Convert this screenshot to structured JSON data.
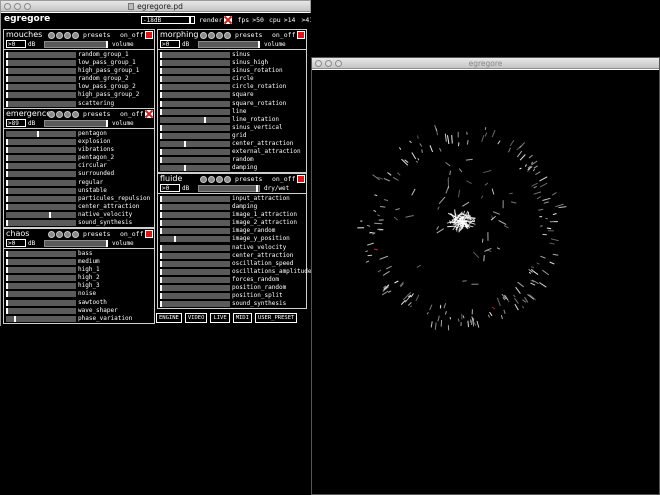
{
  "pd_window": {
    "title": "egregore.pd",
    "app_title": "egregore",
    "top": {
      "level": "-18dB",
      "level_fill": 0.85,
      "render_label": "render",
      "fps_label": "fps",
      "fps_value": ">50",
      "cpu_label": "cpu",
      "cpu_value": ">14",
      "extra_value": ">41"
    },
    "sections": {
      "mouches": {
        "title": "mouches",
        "presets_label": "presets",
        "onoff_label": "on_off",
        "onoff_state": "red",
        "vol_value": ">0",
        "unit": "dB",
        "vol_label": "volume",
        "vol_fill": 1.0,
        "params": [
          {
            "label": "random_group_1",
            "value": 0.0
          },
          {
            "label": "low_pass_group_1",
            "value": 0.0
          },
          {
            "label": "high_pass_group_1",
            "value": 0.0
          },
          {
            "label": "random_group_2",
            "value": 0.0
          },
          {
            "label": "low_pass_group_2",
            "value": 0.0
          },
          {
            "label": "high_pass_group_2",
            "value": 0.0
          },
          {
            "label": "scattering",
            "value": 0.0
          }
        ]
      },
      "emergence": {
        "title": "emergence",
        "presets_label": "presets",
        "onoff_label": "on_off",
        "onoff_state": "x",
        "vol_value": ">89",
        "unit": "dB",
        "vol_label": "volume",
        "vol_fill": 1.0,
        "params": [
          {
            "label": "pentagon",
            "value": 0.45
          },
          {
            "label": "explosion",
            "value": 0.0
          },
          {
            "label": "vibrations",
            "value": 0.0
          },
          {
            "label": "pentagon_2",
            "value": 0.0
          },
          {
            "label": "circular",
            "value": 0.0
          },
          {
            "label": "surrounded",
            "value": 0.0
          },
          {
            "label": "regular",
            "value": 0.0
          },
          {
            "label": "unstable",
            "value": 0.0
          },
          {
            "label": "particules_repulsion",
            "value": 0.0
          },
          {
            "label": "center_attraction",
            "value": 0.0
          },
          {
            "label": "native_velocity",
            "value": 0.63
          },
          {
            "label": "sound_synthesis",
            "value": 0.0
          }
        ]
      },
      "chaos": {
        "title": "chaos",
        "presets_label": "presets",
        "onoff_label": "on_off",
        "onoff_state": "red",
        "vol_value": ">0",
        "unit": "dB",
        "vol_label": "volume",
        "vol_fill": 1.0,
        "params": [
          {
            "label": "bass",
            "value": 0.0
          },
          {
            "label": "medium",
            "value": 0.0
          },
          {
            "label": "high_1",
            "value": 0.0
          },
          {
            "label": "high_2",
            "value": 0.0
          },
          {
            "label": "high_3",
            "value": 0.0
          },
          {
            "label": "noise",
            "value": 0.0
          },
          {
            "label": "sawtooth",
            "value": 0.0
          },
          {
            "label": "wave_shaper",
            "value": 0.0
          },
          {
            "label": "phase_variation",
            "value": 0.12
          }
        ]
      },
      "morphing": {
        "title": "morphing",
        "presets_label": "presets",
        "onoff_label": "on_off",
        "onoff_state": "red",
        "vol_value": ">0",
        "unit": "dB",
        "vol_label": "volume",
        "vol_fill": 1.0,
        "params": [
          {
            "label": "sinus",
            "value": 0.0
          },
          {
            "label": "sinus_high",
            "value": 0.0
          },
          {
            "label": "sinus_rotation",
            "value": 0.0
          },
          {
            "label": "circle",
            "value": 0.0
          },
          {
            "label": "circle_rotation",
            "value": 0.0
          },
          {
            "label": "square",
            "value": 0.0
          },
          {
            "label": "square_rotation",
            "value": 0.0
          },
          {
            "label": "line",
            "value": 0.0
          },
          {
            "label": "line_rotation",
            "value": 0.65
          },
          {
            "label": "sinus_vertical",
            "value": 0.0
          },
          {
            "label": "grid",
            "value": 0.0
          },
          {
            "label": "center_attraction",
            "value": 0.35
          },
          {
            "label": "external_attraction",
            "value": 0.0
          },
          {
            "label": "random",
            "value": 0.0
          },
          {
            "label": "damping",
            "value": 0.35
          }
        ]
      },
      "fluide": {
        "title": "fluide",
        "presets_label": "presets",
        "onoff_label": "on_off",
        "onoff_state": "red",
        "vol_value": ">0",
        "unit": "dB",
        "vol_label": "dry/wet",
        "vol_fill": 0.97,
        "params": [
          {
            "label": "input_attraction",
            "value": 0.0
          },
          {
            "label": "damping",
            "value": 0.0
          },
          {
            "label": "image_1_attraction",
            "value": 0.0
          },
          {
            "label": "image_2_attraction",
            "value": 0.0
          },
          {
            "label": "image_random",
            "value": 0.0
          },
          {
            "label": "image_y_position",
            "value": 0.2
          },
          {
            "label": "native_velocity",
            "value": 0.0
          },
          {
            "label": "center_attraction",
            "value": 0.0
          },
          {
            "label": "oscillation_speed",
            "value": 0.0
          },
          {
            "label": "oscillations_amplitude",
            "value": 0.0
          },
          {
            "label": "forces_random",
            "value": 0.0
          },
          {
            "label": "position_random",
            "value": 0.0
          },
          {
            "label": "position_split",
            "value": 0.0
          },
          {
            "label": "sound_synthesis",
            "value": 0.0
          }
        ]
      }
    },
    "buttons": [
      "ENGINE",
      "VIDEO",
      "LIVE",
      "MIDI",
      "USER_PRESET"
    ]
  },
  "render_window": {
    "title": "egregore"
  },
  "colors": {
    "accent_red": "#e11414",
    "slider_bg": "#5a5a5a",
    "particle_accent": "#c83232"
  }
}
